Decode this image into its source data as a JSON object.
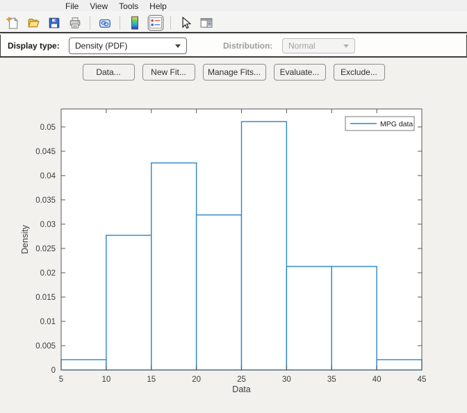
{
  "menu": {
    "items": [
      "File",
      "View",
      "Tools",
      "Help"
    ]
  },
  "toolbar": {
    "icons": [
      "new-figure",
      "open-file",
      "save-figure",
      "print-figure",
      "link-plot",
      "insert-colorbar",
      "insert-legend",
      "edit-plot",
      "show-plot-tools"
    ],
    "selected_icon": "insert-legend"
  },
  "controls": {
    "display_type_label": "Display type:",
    "display_type_value": "Density (PDF)",
    "distribution_label": "Distribution:",
    "distribution_value": "Normal",
    "distribution_enabled": false
  },
  "actions": {
    "buttons": [
      "Data...",
      "New Fit...",
      "Manage Fits...",
      "Evaluate...",
      "Exclude..."
    ]
  },
  "chart_data": {
    "type": "histogram",
    "xlabel": "Data",
    "ylabel": "Density",
    "bin_edges": [
      5,
      10,
      15,
      20,
      25,
      30,
      35,
      40,
      45
    ],
    "densities": [
      0.0021,
      0.0277,
      0.0426,
      0.0319,
      0.0511,
      0.0213,
      0.0213,
      0.0021
    ],
    "xlim": [
      5,
      45
    ],
    "ylim": [
      0,
      0.0537
    ],
    "x_ticks": [
      5,
      10,
      15,
      20,
      25,
      30,
      35,
      40,
      45
    ],
    "x_tick_labels": [
      "5",
      "10",
      "15",
      "20",
      "25",
      "30",
      "35",
      "40",
      "45"
    ],
    "y_ticks": [
      0,
      0.005,
      0.01,
      0.015,
      0.02,
      0.025,
      0.03,
      0.035,
      0.04,
      0.045,
      0.05
    ],
    "y_tick_labels": [
      "0",
      "0.005",
      "0.01",
      "0.015",
      "0.02",
      "0.025",
      "0.03",
      "0.035",
      "0.04",
      "0.045",
      "0.05"
    ],
    "legend": {
      "label": "MPG data",
      "position": "northeast"
    },
    "colors": {
      "series": "#2a85c7",
      "axis": "#555555",
      "tick_label": "#3c3c3c",
      "axes_bg": "#ffffff"
    },
    "box": true,
    "grid": false
  }
}
